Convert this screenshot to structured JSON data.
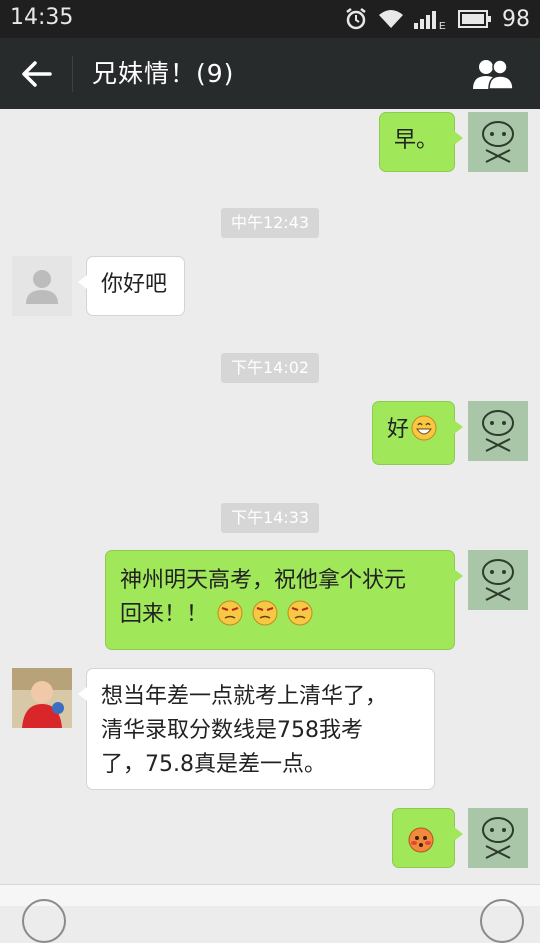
{
  "status_bar": {
    "time": "14:35",
    "battery": "98"
  },
  "header": {
    "title": "兄妹情！(9)"
  },
  "messages": {
    "m1": {
      "text": "早。"
    },
    "t1": {
      "text": "中午12:43"
    },
    "m2": {
      "text": "你好吧"
    },
    "t2": {
      "text": "下午14:02"
    },
    "m3": {
      "text": "好"
    },
    "t3": {
      "text": "下午14:33"
    },
    "m4": {
      "line1": "神州明天高考，祝他拿个状元",
      "line2": "回来！！"
    },
    "m5": {
      "line1": "想当年差一点就考上清华了，",
      "line2": "清华录取分数线是758我考",
      "line3": "了，75.8真是差一点。"
    }
  },
  "icons": {
    "status": [
      "alarm-icon",
      "wifi-icon",
      "signal-icon",
      "battery-icon"
    ],
    "header": [
      "back-arrow-icon",
      "group-members-icon"
    ],
    "emoji": [
      "grin-emoji",
      "annoyed-emoji",
      "blush-emoji"
    ]
  },
  "colors": {
    "outgoing_bubble": "#a0e75a",
    "incoming_bubble": "#ffffff",
    "title_bar": "#272b2c",
    "chat_background": "#ececec"
  }
}
